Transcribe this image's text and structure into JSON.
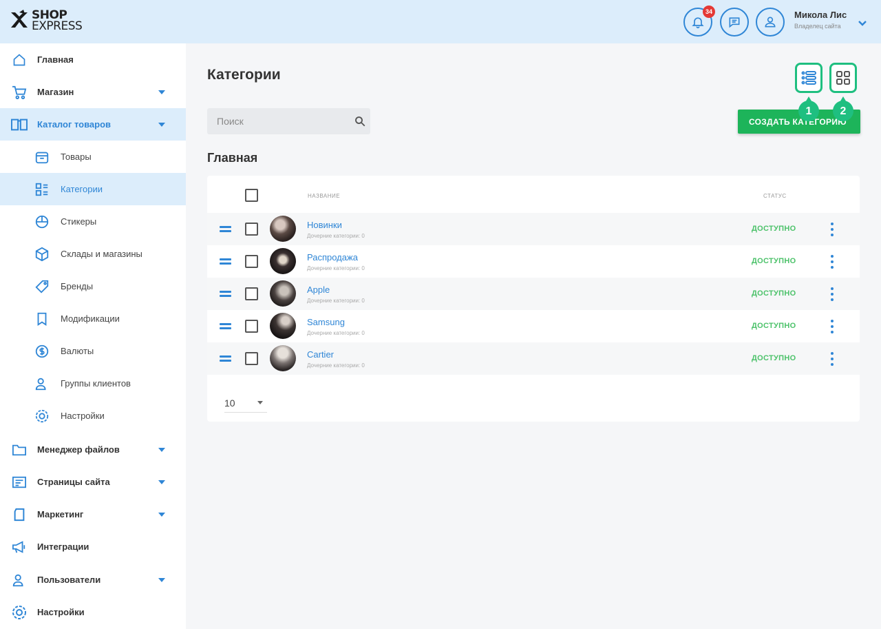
{
  "header": {
    "logo_line1": "SHOP",
    "logo_line2": "EXPRESS",
    "notifications_count": "34",
    "user_name": "Микола Лис",
    "user_role": "Владелец сайта"
  },
  "sidebar": {
    "items": [
      {
        "label": "Главная",
        "icon": "home-icon"
      },
      {
        "label": "Магазин",
        "icon": "cart-icon",
        "has_caret": true
      },
      {
        "label": "Каталог товаров",
        "icon": "catalog-icon",
        "has_caret": true,
        "active": true
      },
      {
        "label": "Менеджер файлов",
        "icon": "folder-icon",
        "has_caret": true
      },
      {
        "label": "Страницы сайта",
        "icon": "pages-icon",
        "has_caret": true
      },
      {
        "label": "Маркетинг",
        "icon": "marketing-icon",
        "has_caret": true
      },
      {
        "label": "Интеграции",
        "icon": "megaphone-icon"
      },
      {
        "label": "Пользователи",
        "icon": "users-icon",
        "has_caret": true
      },
      {
        "label": "Настройки",
        "icon": "settings-icon"
      }
    ],
    "subitems": [
      {
        "label": "Товары",
        "icon": "box-icon"
      },
      {
        "label": "Категории",
        "icon": "categories-icon",
        "active": true
      },
      {
        "label": "Стикеры",
        "icon": "sticker-icon"
      },
      {
        "label": "Склады и магазины",
        "icon": "warehouse-icon"
      },
      {
        "label": "Бренды",
        "icon": "tag-icon"
      },
      {
        "label": "Модификации",
        "icon": "bookmark-icon"
      },
      {
        "label": "Валюты",
        "icon": "currency-icon"
      },
      {
        "label": "Группы клиентов",
        "icon": "client-group-icon"
      },
      {
        "label": "Настройки",
        "icon": "gear-icon"
      }
    ]
  },
  "main": {
    "title": "Категории",
    "search_placeholder": "Поиск",
    "create_label": "СОЗДАТЬ КАТЕГОРИЮ",
    "pins": [
      "1",
      "2"
    ],
    "section_title": "Главная",
    "col_name": "НАЗВАНИЕ",
    "col_status": "СТАТУС",
    "rows": [
      {
        "name": "Новинки",
        "sub": "Дочерние категории: 0",
        "status": "ДОСТУПНО"
      },
      {
        "name": "Распродажа",
        "sub": "Дочерние категории: 0",
        "status": "ДОСТУПНО"
      },
      {
        "name": "Apple",
        "sub": "Дочерние категории: 0",
        "status": "ДОСТУПНО"
      },
      {
        "name": "Samsung",
        "sub": "Дочерние категории: 0",
        "status": "ДОСТУПНО"
      },
      {
        "name": "Cartier",
        "sub": "Дочерние категории: 0",
        "status": "ДОСТУПНО"
      }
    ],
    "per_page": "10"
  },
  "colors": {
    "accent": "#2f86d6",
    "header_bg": "#dcedfb",
    "create_button": "#1db45a",
    "status_available": "#4cc26a",
    "highlight": "#1fbf80",
    "badge": "#e53935"
  }
}
